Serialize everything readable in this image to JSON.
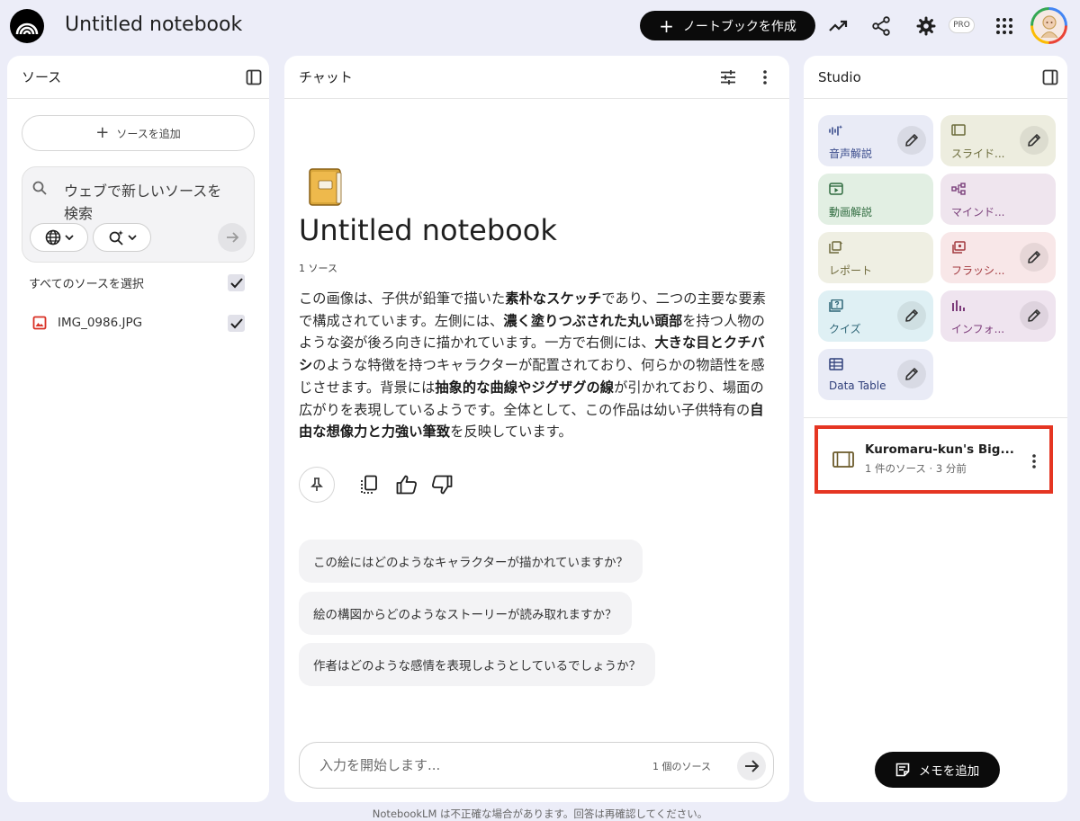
{
  "app": {
    "title": "Untitled notebook",
    "create_label": "ノートブックを作成",
    "pro_badge": "PRO",
    "footer_note": "NotebookLM は不正確な場合があります。回答は再確認してください。"
  },
  "sources": {
    "header": "ソース",
    "add_label": "ソースを追加",
    "search_text": "ウェブで新しいソースを検索",
    "select_all_label": "すべてのソースを選択",
    "select_all_checked": true,
    "items": [
      {
        "name": "IMG_0986.JPG",
        "checked": true
      }
    ]
  },
  "chat": {
    "header": "チャット",
    "notebook_title": "Untitled notebook",
    "source_count": "1 ソース",
    "summary_parts": [
      {
        "text": "この画像は、子供が鉛筆で描いた",
        "bold": false
      },
      {
        "text": "素朴なスケッチ",
        "bold": true
      },
      {
        "text": "であり、二つの主要な要素で構成されています。左側には、",
        "bold": false
      },
      {
        "text": "濃く塗りつぶされた丸い頭部",
        "bold": true
      },
      {
        "text": "を持つ人物のような姿が後ろ向きに描かれています。一方で右側には、",
        "bold": false
      },
      {
        "text": "大きな目とクチバシ",
        "bold": true
      },
      {
        "text": "のような特徴を持つキャラクターが配置されており、何らかの物語性を感じさせます。背景には",
        "bold": false
      },
      {
        "text": "抽象的な曲線やジグザグの線",
        "bold": true
      },
      {
        "text": "が引かれており、場面の広がりを表現しているようです。全体として、この作品は幼い子供特有の",
        "bold": false
      },
      {
        "text": "自由な想像力と力強い筆致",
        "bold": true
      },
      {
        "text": "を反映しています。",
        "bold": false
      }
    ],
    "suggestions": [
      "この絵にはどのようなキャラクターが描かれていますか？",
      "絵の構図からどのようなストーリーが読み取れますか？",
      "作者はどのような感情を表現しようとしているでしょうか？"
    ],
    "input_placeholder": "入力を開始します...",
    "input_source_count": "1 個のソース"
  },
  "studio": {
    "header": "Studio",
    "tiles": [
      {
        "label": "音声解説",
        "icon": "audio-waveform-icon",
        "bg": "#e9ebf6",
        "color": "#3a4c8c",
        "editable": true
      },
      {
        "label": "スライド...",
        "icon": "slides-icon",
        "bg": "#ededdf",
        "color": "#6b6b3a",
        "editable": true
      },
      {
        "label": "動画解説",
        "icon": "video-icon",
        "bg": "#e2efe3",
        "color": "#2f6b3f",
        "editable": false
      },
      {
        "label": "マインド...",
        "icon": "mind-map-icon",
        "bg": "#efe5ee",
        "color": "#7a3f7a",
        "editable": false
      },
      {
        "label": "レポート",
        "icon": "report-icon",
        "bg": "#efefe3",
        "color": "#6f6a3c",
        "editable": false
      },
      {
        "label": "フラッシ...",
        "icon": "flashcards-icon",
        "bg": "#f8e7e8",
        "color": "#a33a3f",
        "editable": true
      },
      {
        "label": "クイズ",
        "icon": "quiz-icon",
        "bg": "#dff0f4",
        "color": "#2f6677",
        "editable": true
      },
      {
        "label": "インフォ...",
        "icon": "infographic-icon",
        "bg": "#efe4ef",
        "color": "#7c3b7a",
        "editable": true
      },
      {
        "label": "Data Table",
        "icon": "data-table-icon",
        "bg": "#e9ebf6",
        "color": "#2f3f7a",
        "editable": true
      }
    ],
    "note": {
      "title": "Kuromaru-kun's Big...",
      "meta": "1 件のソース · 3 分前"
    },
    "add_note_label": "メモを追加"
  },
  "colors": {
    "background": "#ecedf8",
    "highlight_border": "#e53522",
    "primary_button": "#0b0b0b"
  }
}
